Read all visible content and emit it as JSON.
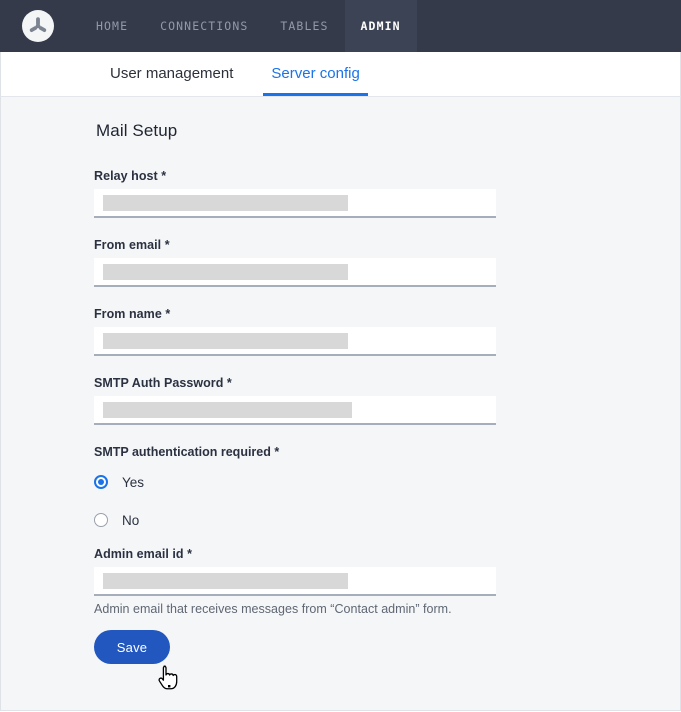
{
  "topnav": {
    "logo_icon": "propeller-logo-icon",
    "items": [
      {
        "label": "HOME",
        "active": false
      },
      {
        "label": "CONNECTIONS",
        "active": false
      },
      {
        "label": "TABLES",
        "active": false
      },
      {
        "label": "ADMIN",
        "active": true
      }
    ]
  },
  "tabs": [
    {
      "label": "User management",
      "active": false
    },
    {
      "label": "Server config",
      "active": true
    }
  ],
  "panel": {
    "title": "Mail Setup",
    "fields": [
      {
        "label": "Relay host *",
        "value": "",
        "redacted": true
      },
      {
        "label": "From email *",
        "value": "",
        "redacted": true
      },
      {
        "label": "From name *",
        "value": "",
        "redacted": true
      },
      {
        "label": "SMTP Auth Password *",
        "value": "",
        "redacted": true
      }
    ],
    "radio_group": {
      "label": "SMTP authentication required *",
      "options": [
        {
          "label": "Yes",
          "selected": true
        },
        {
          "label": "No",
          "selected": false
        }
      ]
    },
    "admin_email": {
      "label": "Admin email id *",
      "value": "",
      "help": "Admin email that receives messages from “Contact admin” form."
    },
    "save_label": "Save"
  },
  "colors": {
    "nav_background": "#343a4a",
    "nav_active_background": "#3c4354",
    "accent_blue": "#1a73e8",
    "button_blue": "#2157bf",
    "panel_background": "#f5f6f8",
    "redaction_gray": "#d8d8d8"
  }
}
